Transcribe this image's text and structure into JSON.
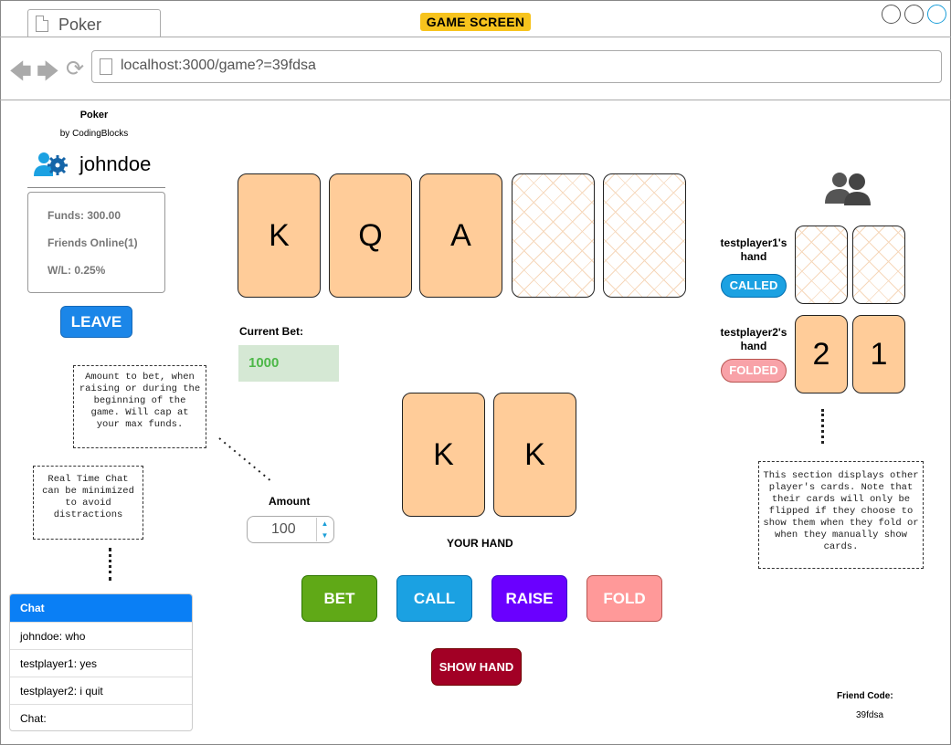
{
  "browser": {
    "tab_title": "Poker",
    "screen_badge": "GAME SCREEN",
    "url": "localhost:3000/game?=39fdsa"
  },
  "sidebar": {
    "app_title": "Poker",
    "app_subtitle": "by CodingBlocks",
    "username": "johndoe",
    "stats": {
      "funds": "Funds: 300.00",
      "friends": "Friends Online(1)",
      "wl": "W/L: 0.25%"
    },
    "leave_label": "LEAVE"
  },
  "notes": {
    "amount": "Amount to bet, when raising or during the beginning of the game. Will cap at your max funds.",
    "chat": "Real Time Chat can be minimized to avoid distractions",
    "players": "This section displays other player's cards. Note that their cards will only be flipped if they choose to show them when they fold or when they manually show cards."
  },
  "chat": {
    "header": "Chat",
    "messages": [
      "johndoe: who",
      "testplayer1: yes",
      "testplayer2: i quit"
    ],
    "input_label": "Chat:"
  },
  "table": {
    "community_cards": [
      "K",
      "Q",
      "A",
      "",
      ""
    ],
    "current_bet_label": "Current Bet:",
    "current_bet_value": "1000",
    "amount_label": "Amount",
    "amount_value": "100",
    "hand_cards": [
      "K",
      "K"
    ],
    "your_hand_label": "YOUR HAND"
  },
  "actions": {
    "bet": "BET",
    "call": "CALL",
    "raise": "RAISE",
    "fold": "FOLD",
    "show_hand": "SHOW HAND"
  },
  "players": [
    {
      "label": "testplayer1's hand",
      "status": "CALLED",
      "cards": [
        "",
        ""
      ]
    },
    {
      "label": "testplayer2's hand",
      "status": "FOLDED",
      "cards": [
        "2",
        "1"
      ]
    }
  ],
  "friend": {
    "label": "Friend Code:",
    "code": "39fdsa"
  },
  "colors": {
    "card_face": "#ffcc99",
    "bet": "#60a917",
    "call": "#1ba1e2",
    "raise": "#6a00ff",
    "fold": "#ff9999",
    "show_hand": "#a20025",
    "leave": "#1b86e8",
    "chat_header": "#0a7ff5"
  }
}
